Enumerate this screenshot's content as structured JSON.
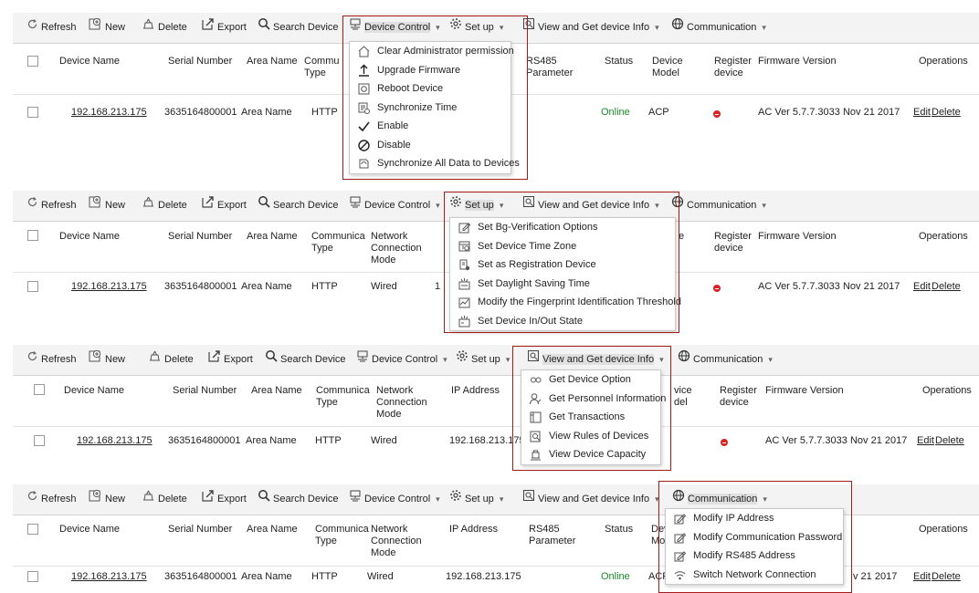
{
  "toolbar": {
    "refresh": "Refresh",
    "new": "New",
    "delete": "Delete",
    "export": "Export",
    "search_device": "Search Device",
    "device_control": "Device Control",
    "set_up": "Set up",
    "view_info": "View and Get device Info",
    "communication": "Communication"
  },
  "columns": {
    "device_name": "Device Name",
    "serial_number": "Serial Number",
    "area_name": "Area Name",
    "comm_type": "Communica Type",
    "comm_type_short": "Commu Type",
    "network_mode": "Network Connection Mode",
    "ip_address": "IP Address",
    "rs485": "RS485 Parameter",
    "status": "Status",
    "device_model": "Device Model",
    "register_device": "Register device",
    "firmware": "Firmware Version",
    "operations": "Operations"
  },
  "row": {
    "device_name": "192.168.213.175",
    "serial_number": "3635164800001",
    "area_name": "Area Name",
    "comm_type": "HTTP",
    "network_mode": "Wired",
    "ip_address": "192.168.213.175",
    "status": "Online",
    "device_model": "ACP",
    "firmware": "AC Ver 5.7.7.3033 Nov 21 2017",
    "firmware_partial": "v 21 2017",
    "edit": "Edit",
    "delete": "Delete"
  },
  "partial": {
    "ip_cut": "1",
    "model_cut_1": "vice",
    "model_cut_2": "del",
    "model_cut_3": "e",
    "model_cut_4": "Dev",
    "model_cut_5": "Moc"
  },
  "menus": {
    "device_control": [
      "Clear Administrator permission",
      "Upgrade Firmware",
      "Reboot Device",
      "Synchronize Time",
      "Enable",
      "Disable",
      "Synchronize All Data to Devices"
    ],
    "set_up": [
      "Set Bg-Verification Options",
      "Set Device Time Zone",
      "Set as Registration Device",
      "Set Daylight Saving Time",
      "Modify the Fingerprint Identification Threshold",
      "Set Device In/Out State"
    ],
    "view_info": [
      "Get Device Option",
      "Get Personnel Information",
      "Get Transactions",
      "View Rules of Devices",
      "View Device Capacity"
    ],
    "communication": [
      "Modify IP Address",
      "Modify Communication Password",
      "Modify RS485 Address",
      "Switch Network Connection"
    ]
  },
  "colors": {
    "highlight_border": "#a31c1c",
    "online": "#1a8a28",
    "not_registered": "#dd2222"
  }
}
